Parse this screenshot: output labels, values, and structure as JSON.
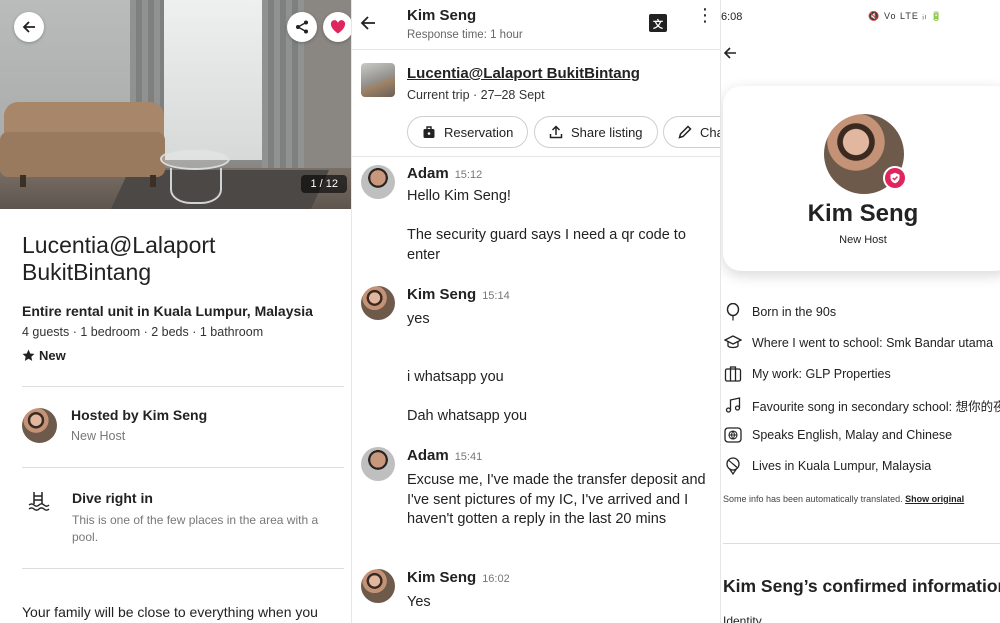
{
  "listing_page": {
    "photo_counter": "1 / 12",
    "title": "Lucentia@Lalaport BukitBintang",
    "subtitle": "Entire rental unit in Kuala Lumpur, Malaysia",
    "details": "4 guests · 1 bedroom · 2 beds · 1 bathroom",
    "rating_label": "New",
    "host_title": "Hosted by Kim Seng",
    "host_role": "New Host",
    "feature_title": "Dive right in",
    "feature_desc": "This is one of the few places in the area with a pool.",
    "bottom_text": "Your family will be close to everything when you",
    "colors": {
      "favorite": "#e0245e"
    }
  },
  "chat": {
    "name": "Kim Seng",
    "response_time": "Response time: 1 hour",
    "listing_title": "Lucentia@Lalaport BukitBintang",
    "trip": "Current trip · 27–28 Sept",
    "chips": [
      "Reservation",
      "Share listing",
      "Cha"
    ],
    "messages": [
      {
        "sender": "Adam",
        "time": "15:12",
        "texts": [
          "Hello Kim Seng!",
          "The security guard says I need a qr code to enter"
        ]
      },
      {
        "sender": "Kim Seng",
        "time": "15:14",
        "texts": [
          "yes",
          "i whatsapp you",
          "Dah whatsapp you"
        ]
      },
      {
        "sender": "Adam",
        "time": "15:41",
        "texts": [
          "Excuse me, I've made the transfer deposit and I've sent pictures of my IC, I've arrived and I haven't gotten a reply in the last 20 mins"
        ]
      },
      {
        "sender": "Kim Seng",
        "time": "16:02",
        "texts": [
          "Yes"
        ]
      }
    ]
  },
  "profile": {
    "status_time": "6:08",
    "status_icons": "🔇 Vo LTE ᵢₗ 🔋",
    "name": "Kim Seng",
    "role": "New Host",
    "info": [
      {
        "icon": "balloon-icon",
        "text": "Born in the 90s"
      },
      {
        "icon": "graduation-cap-icon",
        "text": "Where I went to school: Smk Bandar utama"
      },
      {
        "icon": "briefcase-icon",
        "text": "My work: GLP Properties"
      },
      {
        "icon": "music-note-icon",
        "text": "Favourite song in secondary school: 想你的夜"
      },
      {
        "icon": "globe-icon",
        "text": "Speaks English, Malay and Chinese"
      },
      {
        "icon": "location-icon",
        "text": "Lives in Kuala Lumpur, Malaysia"
      }
    ],
    "translated_note": "Some info has been automatically translated.",
    "show_original": "Show original",
    "confirmed_title": "Kim Seng’s confirmed information",
    "cut_text": "Identity",
    "colors": {
      "badge": "#e0245e"
    }
  }
}
